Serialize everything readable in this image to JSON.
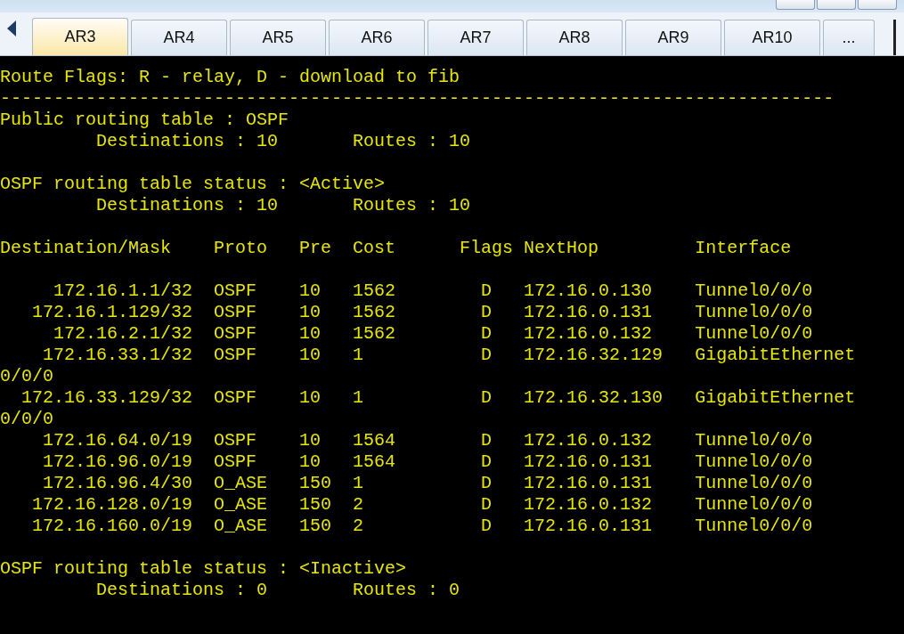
{
  "tabs": [
    {
      "label": "AR3",
      "selected": true
    },
    {
      "label": "AR4",
      "selected": false
    },
    {
      "label": "AR5",
      "selected": false
    },
    {
      "label": "AR6",
      "selected": false
    },
    {
      "label": "AR7",
      "selected": false
    },
    {
      "label": "AR8",
      "selected": false
    },
    {
      "label": "AR9",
      "selected": false
    },
    {
      "label": "AR10",
      "selected": false
    },
    {
      "label": "...",
      "selected": false
    }
  ],
  "terminal": {
    "lines": [
      {
        "kind": "text",
        "text": "Route Flags: R - relay, D - download to fib"
      },
      {
        "kind": "text",
        "text": "------------------------------------------------------------------------------"
      },
      {
        "kind": "text",
        "text": "Public routing table : OSPF"
      },
      {
        "kind": "text",
        "text": "         Destinations : 10       Routes : 10"
      },
      {
        "kind": "blank"
      },
      {
        "kind": "text",
        "text": "OSPF routing table status : <Active>"
      },
      {
        "kind": "text",
        "text": "         Destinations : 10       Routes : 10"
      },
      {
        "kind": "blank"
      },
      {
        "kind": "text",
        "text": "Destination/Mask    Proto   Pre  Cost      Flags NextHop         Interface"
      },
      {
        "kind": "blank"
      },
      {
        "kind": "text",
        "text": "     172.16.1.1/32  OSPF    10   1562        D   172.16.0.130    Tunnel0/0/0"
      },
      {
        "kind": "text",
        "text": "   172.16.1.129/32  OSPF    10   1562        D   172.16.0.131    Tunnel0/0/0"
      },
      {
        "kind": "text",
        "text": "     172.16.2.1/32  OSPF    10   1562        D   172.16.0.132    Tunnel0/0/0"
      },
      {
        "kind": "text",
        "text": "    172.16.33.1/32  OSPF    10   1           D   172.16.32.129   GigabitEthernet"
      },
      {
        "kind": "text",
        "text": "0/0/0"
      },
      {
        "kind": "text",
        "text": "  172.16.33.129/32  OSPF    10   1           D   172.16.32.130   GigabitEthernet"
      },
      {
        "kind": "text",
        "text": "0/0/0"
      },
      {
        "kind": "text",
        "text": "    172.16.64.0/19  OSPF    10   1564        D   172.16.0.132    Tunnel0/0/0"
      },
      {
        "kind": "text",
        "text": "    172.16.96.0/19  OSPF    10   1564        D   172.16.0.131    Tunnel0/0/0"
      },
      {
        "kind": "text",
        "text": "    172.16.96.4/30  O_ASE   150  1           D   172.16.0.131    Tunnel0/0/0"
      },
      {
        "kind": "text",
        "text": "   172.16.128.0/19  O_ASE   150  2           D   172.16.0.132    Tunnel0/0/0"
      },
      {
        "kind": "text",
        "text": "   172.16.160.0/19  O_ASE   150  2           D   172.16.0.131    Tunnel0/0/0"
      },
      {
        "kind": "blank"
      },
      {
        "kind": "text",
        "text": "OSPF routing table status : <Inactive>"
      },
      {
        "kind": "text",
        "text": "         Destinations : 0        Routes : 0"
      }
    ]
  }
}
